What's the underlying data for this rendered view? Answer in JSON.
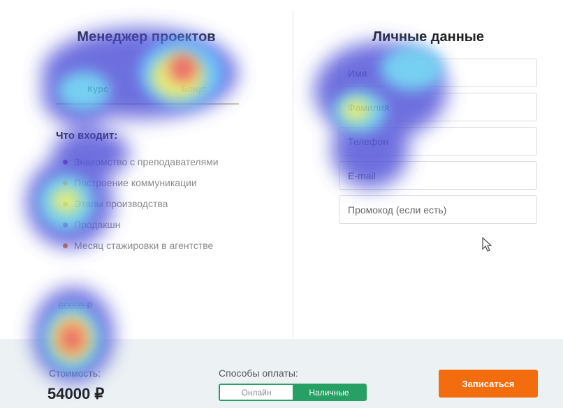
{
  "course": {
    "title": "Менеджер проектов",
    "tabs": [
      {
        "label": "Курс"
      },
      {
        "label": "Бонус"
      }
    ],
    "includes_title": "Что входит:",
    "includes": [
      {
        "label": "Знакомство с преподавателями",
        "color": "#7b2d8e"
      },
      {
        "label": "Построение коммуникации",
        "color": "#f5a623"
      },
      {
        "label": "Этапы производства",
        "color": "#8ec07c"
      },
      {
        "label": "Продакшн",
        "color": "#7b2d8e"
      },
      {
        "label": "Месяц стажировки в агентстве",
        "color": "#f07820"
      }
    ],
    "old_price": "60000 ₽"
  },
  "personal": {
    "title": "Личные данные",
    "fields": [
      {
        "placeholder": "Имя"
      },
      {
        "placeholder": "Фамилия"
      },
      {
        "placeholder": "Телефон"
      },
      {
        "placeholder": "E-mail"
      },
      {
        "placeholder": "Промокод (если есть)"
      }
    ]
  },
  "footer": {
    "cost_label": "Стоимость:",
    "cost_value": "54000 ₽",
    "payment_label": "Способы оплаты:",
    "payment_options": [
      {
        "label": "Онлайн",
        "selected": false
      },
      {
        "label": "Наличные",
        "selected": true
      }
    ],
    "submit_label": "Записаться"
  },
  "colors": {
    "accent_green": "#27a065",
    "accent_orange": "#f36c0e"
  }
}
